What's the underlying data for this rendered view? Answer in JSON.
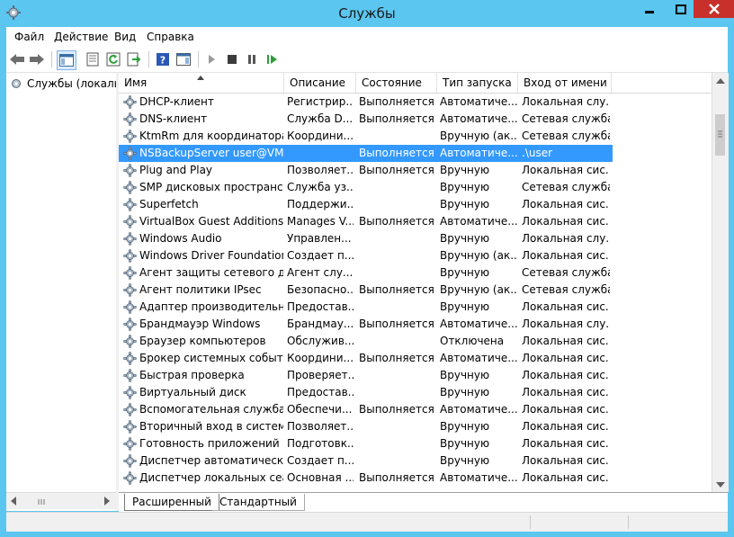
{
  "window": {
    "title": "Службы"
  },
  "menu": [
    "Файл",
    "Действие",
    "Вид",
    "Справка"
  ],
  "toolbar": {
    "icons": [
      "back-arrow-icon",
      "forward-arrow-icon",
      "console-tree-icon",
      "properties-icon",
      "refresh-icon",
      "export-list-icon",
      "help-icon",
      "show-action-pane-icon",
      "start-service-icon",
      "stop-service-icon",
      "pause-service-icon",
      "resume-service-icon"
    ]
  },
  "tree": {
    "root_label": "Службы (локаль"
  },
  "columns": {
    "name": "Имя",
    "description": "Описание",
    "state": "Состояние",
    "startup": "Тип запуска",
    "logon": "Вход от имени"
  },
  "services": [
    {
      "name": "DHCP-клиент",
      "description": "Регистрир...",
      "state": "Выполняется",
      "startup": "Автоматиче...",
      "logon": "Локальная слу..."
    },
    {
      "name": "DNS-клиент",
      "description": "Служба D...",
      "state": "Выполняется",
      "startup": "Автоматиче...",
      "logon": "Сетевая служба"
    },
    {
      "name": "KtmRm для координатора ...",
      "description": "Координи...",
      "state": "",
      "startup": "Вручную (ак...",
      "logon": "Сетевая служба"
    },
    {
      "name": "NSBackupServer user@VM",
      "description": "",
      "state": "Выполняется",
      "startup": "Автоматиче...",
      "logon": ".\\user",
      "selected": true
    },
    {
      "name": "Plug and Play",
      "description": "Позволяет...",
      "state": "Выполняется",
      "startup": "Вручную",
      "logon": "Локальная сис..."
    },
    {
      "name": "SMP дисковых пространст...",
      "description": "Служба уз...",
      "state": "",
      "startup": "Вручную",
      "logon": "Сетевая служба"
    },
    {
      "name": "Superfetch",
      "description": "Поддержи...",
      "state": "",
      "startup": "Вручную",
      "logon": "Локальная сис..."
    },
    {
      "name": "VirtualBox Guest Additions ...",
      "description": "Manages V...",
      "state": "Выполняется",
      "startup": "Автоматиче...",
      "logon": "Локальная сис..."
    },
    {
      "name": "Windows Audio",
      "description": "Управлен...",
      "state": "",
      "startup": "Вручную",
      "logon": "Локальная слу..."
    },
    {
      "name": "Windows Driver Foundation...",
      "description": "Создает п...",
      "state": "",
      "startup": "Вручную (ак...",
      "logon": "Локальная сис..."
    },
    {
      "name": "Агент защиты сетевого до...",
      "description": "Агент слу...",
      "state": "",
      "startup": "Вручную",
      "logon": "Сетевая служба"
    },
    {
      "name": "Агент политики IPsec",
      "description": "Безопасно...",
      "state": "Выполняется",
      "startup": "Вручную (ак...",
      "logon": "Сетевая служба"
    },
    {
      "name": "Адаптер производительн...",
      "description": "Предостав...",
      "state": "",
      "startup": "Вручную",
      "logon": "Локальная сис..."
    },
    {
      "name": "Брандмауэр Windows",
      "description": "Брандмау...",
      "state": "Выполняется",
      "startup": "Автоматиче...",
      "logon": "Локальная слу..."
    },
    {
      "name": "Браузер компьютеров",
      "description": "Обслужив...",
      "state": "",
      "startup": "Отключена",
      "logon": "Локальная сис..."
    },
    {
      "name": "Брокер системных событий",
      "description": "Координи...",
      "state": "Выполняется",
      "startup": "Автоматиче...",
      "logon": "Локальная сис..."
    },
    {
      "name": "Быстрая проверка",
      "description": "Проверяет...",
      "state": "",
      "startup": "Вручную",
      "logon": "Локальная сис..."
    },
    {
      "name": "Виртуальный диск",
      "description": "Предостав...",
      "state": "",
      "startup": "Вручную",
      "logon": "Локальная сис..."
    },
    {
      "name": "Вспомогательная служба IP",
      "description": "Обеспечи...",
      "state": "Выполняется",
      "startup": "Автоматиче...",
      "logon": "Локальная сис..."
    },
    {
      "name": "Вторичный вход в систему",
      "description": "Позволяет...",
      "state": "",
      "startup": "Вручную",
      "logon": "Локальная сис..."
    },
    {
      "name": "Готовность приложений",
      "description": "Подготовк...",
      "state": "",
      "startup": "Вручную",
      "logon": "Локальная сис..."
    },
    {
      "name": "Диспетчер автоматически...",
      "description": "Создает п...",
      "state": "",
      "startup": "Вручную",
      "logon": "Локальная сис..."
    },
    {
      "name": "Диспетчер локальных сеа...",
      "description": "Основная ...",
      "state": "Выполняется",
      "startup": "Автоматиче...",
      "logon": "Локальная сис..."
    }
  ],
  "tabs": {
    "extended": "Расширенный",
    "standard": "Стандартный"
  },
  "colors": {
    "titlebar": "#5bc6ef",
    "close": "#c7302b",
    "selection": "#3399ff"
  }
}
